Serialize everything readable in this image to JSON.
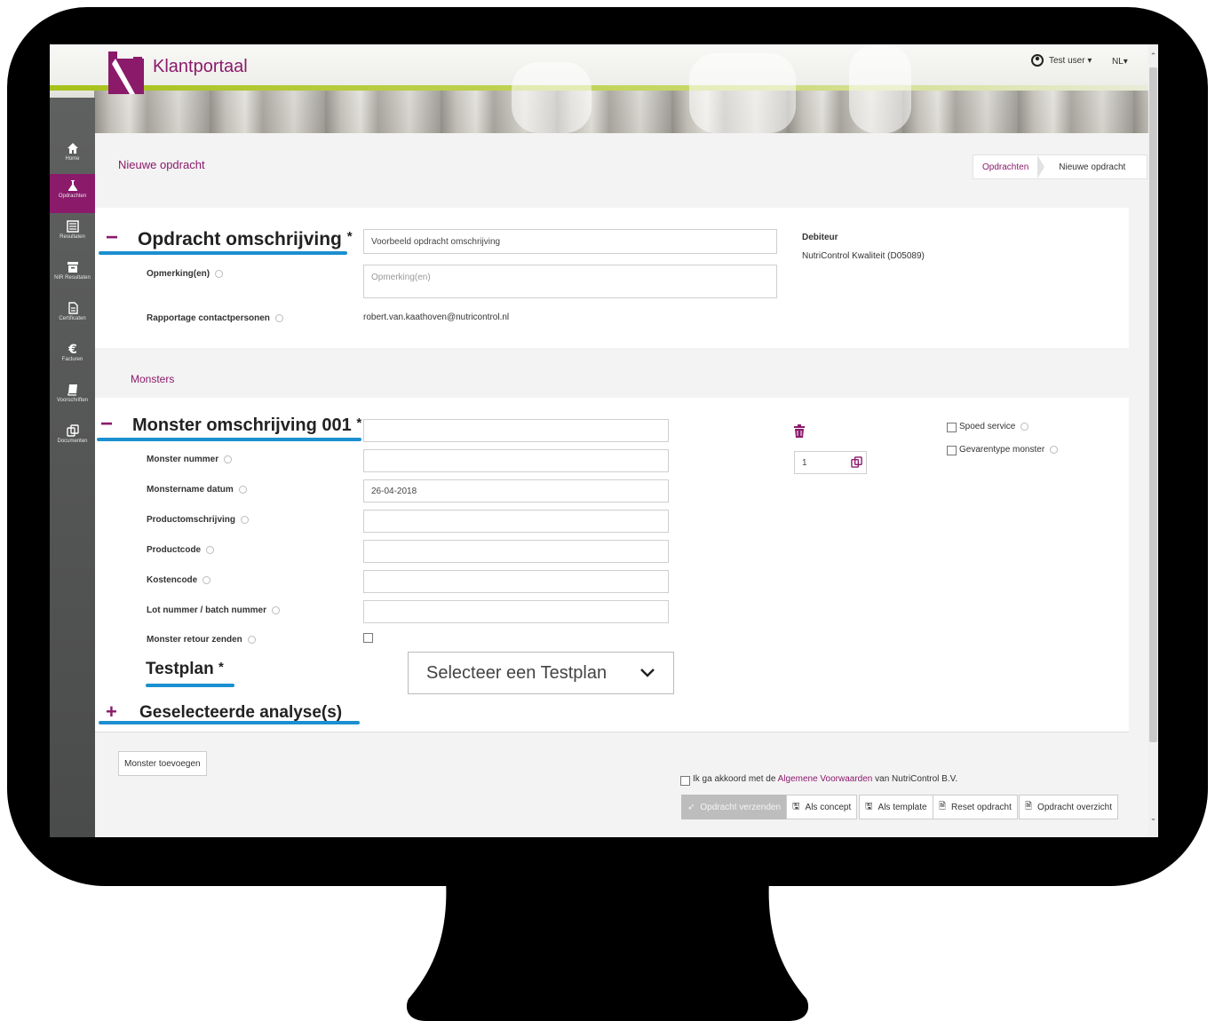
{
  "app": {
    "title": "Klantportaal",
    "user_label": "Test user ▾",
    "language_label": "NL▾"
  },
  "sidebar": {
    "items": [
      {
        "label": "Home",
        "icon": "home-icon"
      },
      {
        "label": "Opdrachten",
        "icon": "flask-icon"
      },
      {
        "label": "Resultaten",
        "icon": "list-icon"
      },
      {
        "label": "NIR Resultaten",
        "icon": "archive-icon"
      },
      {
        "label": "Certificaten",
        "icon": "document-icon"
      },
      {
        "label": "Facturen",
        "icon": "euro-icon"
      },
      {
        "label": "Voorschriften",
        "icon": "book-icon"
      },
      {
        "label": "Documenten",
        "icon": "copy-icon"
      }
    ]
  },
  "page": {
    "title": "Nieuwe opdracht",
    "breadcrumb": [
      "Opdrachten",
      "Nieuwe opdracht"
    ]
  },
  "order": {
    "heading": "Opdracht omschrijving",
    "heading_star": "*",
    "description_value": "Voorbeeld opdracht omschrijving",
    "remarks_label": "Opmerking(en)",
    "remarks_placeholder": "Opmerking(en)",
    "contacts_label": "Rapportage contactpersonen",
    "contacts_value": "robert.van.kaathoven@nutricontrol.nl",
    "debtor_label": "Debiteur",
    "debtor_value": "NutriControl Kwaliteit (D05089)"
  },
  "samples": {
    "section_title": "Monsters",
    "heading": "Monster omschrijving 001",
    "heading_star": "*",
    "fields": [
      {
        "label": "Monster nummer",
        "value": ""
      },
      {
        "label": "Monstername datum",
        "value": "26-04-2018"
      },
      {
        "label": "Productomschrijving",
        "value": ""
      },
      {
        "label": "Productcode",
        "value": ""
      },
      {
        "label": "Kostencode",
        "value": ""
      },
      {
        "label": "Lot nummer / batch nummer",
        "value": ""
      }
    ],
    "return_label": "Monster retour zenden",
    "quantity_value": "1",
    "express_label": "Spoed service",
    "hazard_label": "Gevarentype monster",
    "testplan_heading": "Testplan",
    "testplan_star": "*",
    "testplan_placeholder": "Selecteer een Testplan",
    "analyses_heading": "Geselecteerde analyse(s)",
    "add_sample_label": "Monster toevoegen"
  },
  "footer": {
    "agree_prefix": "Ik ga akkoord met de",
    "agree_link": "Algemene Voorwaarden",
    "agree_suffix": "van NutriControl B.V.",
    "buttons": {
      "send": "Opdracht verzenden",
      "concept": "Als concept",
      "template": "Als template",
      "reset": "Reset opdracht",
      "overview": "Opdracht overzicht"
    }
  },
  "colors": {
    "brand": "#8b1a6b",
    "accent_underline": "#1b8fd0",
    "sidebar": "#555656",
    "header_band": "#a7c11a"
  }
}
